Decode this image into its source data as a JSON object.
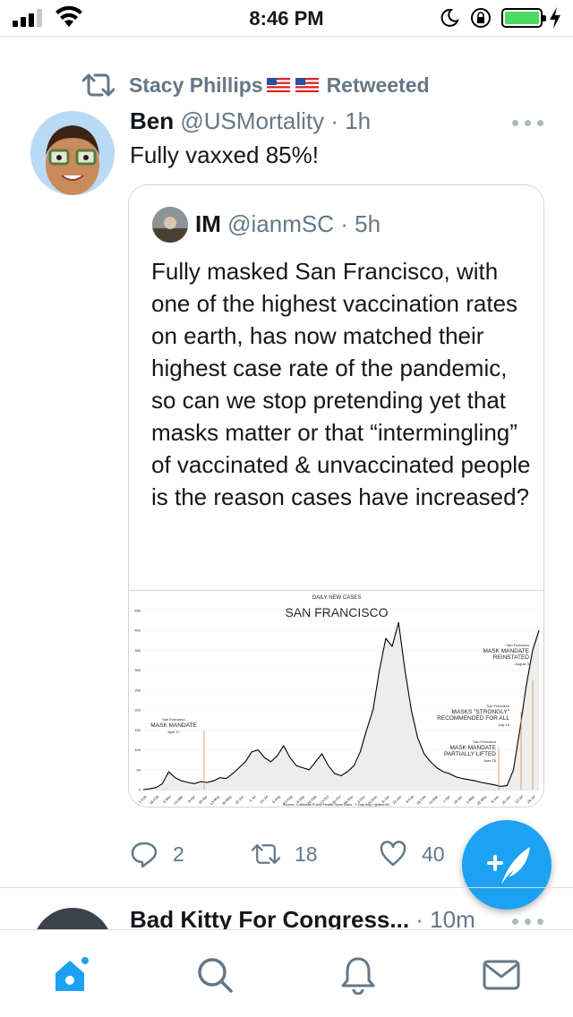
{
  "status_bar": {
    "time": "8:46 PM"
  },
  "retweet_banner": {
    "user": "Stacy Phillips",
    "flags": "🇺🇸 🇺🇸",
    "suffix": "Retweeted"
  },
  "tweet": {
    "name": "Ben",
    "handle": "@USMortality",
    "time": "· 1h",
    "text": "Fully vaxxed 85%!",
    "replies": "2",
    "retweets": "18",
    "likes": "40"
  },
  "quoted": {
    "name": "IM",
    "handle": "@ianmSC",
    "time": "· 5h",
    "text": "Fully masked San Francisco, with one of the highest vaccination rates on earth, has now matched their highest case rate of the pandemic, so can we stop pretending yet that masks matter or that “intermingling” of vaccinated & unvaccinated people is the reason cases have increased?"
  },
  "chart_data": {
    "type": "area",
    "title": "SAN FRANCISCO",
    "subtitle": "DAILY NEW CASES",
    "source": "Source: California Public Health Open Data · 7-Day Avg | @ianmSC",
    "ylim": [
      0,
      450
    ],
    "yticks": [
      0,
      50,
      100,
      150,
      200,
      250,
      300,
      350,
      400,
      450
    ],
    "x_ticks": [
      "1-Feb",
      "18-Feb",
      "6-Mar",
      "23-Mar",
      "9-Apr",
      "26-Apr",
      "13-May",
      "30-May",
      "16-Jun",
      "3-Jul",
      "20-Jul",
      "6-Aug",
      "23-Aug",
      "9-Sep",
      "26-Sep",
      "13-Oct",
      "30-Oct",
      "16-Nov",
      "3-Dec",
      "20-Dec",
      "6-Jan",
      "23-Jan",
      "9-Feb",
      "26-Feb",
      "15-Mar",
      "1-Apr",
      "18-Apr",
      "5-May",
      "22-May",
      "8-Jun",
      "25-Jun",
      "12-Jul",
      "29-Jul"
    ],
    "series": [
      {
        "values": [
          0,
          2,
          5,
          15,
          45,
          30,
          22,
          18,
          15,
          20,
          18,
          22,
          30,
          28,
          40,
          55,
          70,
          95,
          100,
          80,
          70,
          85,
          110,
          80,
          60,
          55,
          50,
          70,
          90,
          60,
          40,
          35,
          45,
          60,
          95,
          150,
          200,
          300,
          380,
          360,
          420,
          300,
          200,
          130,
          90,
          70,
          55,
          45,
          40,
          32,
          28,
          25,
          22,
          18,
          15,
          12,
          8,
          10,
          50,
          150,
          260,
          350,
          400
        ]
      }
    ],
    "annotations": [
      {
        "label": "MASK MANDATE",
        "prefix": "San Francisco",
        "date": "April 17"
      },
      {
        "label": "MASK MANDATE PARTIALLY LIFTED",
        "prefix": "San Francisco",
        "date": "June 15"
      },
      {
        "label": "MASKS \"STRONGLY\" RECOMMENDED FOR ALL",
        "prefix": "San Francisco",
        "date": "July 16"
      },
      {
        "label": "MASK MANDATE REINSTATED",
        "prefix": "San Francisco",
        "date": "August 3"
      }
    ]
  },
  "next_tweet": {
    "name": "Bad Kitty For Congress...",
    "time": "· 10m"
  },
  "colors": {
    "accent": "#1da1f2",
    "muted": "#657786",
    "battery": "#4cd964"
  }
}
